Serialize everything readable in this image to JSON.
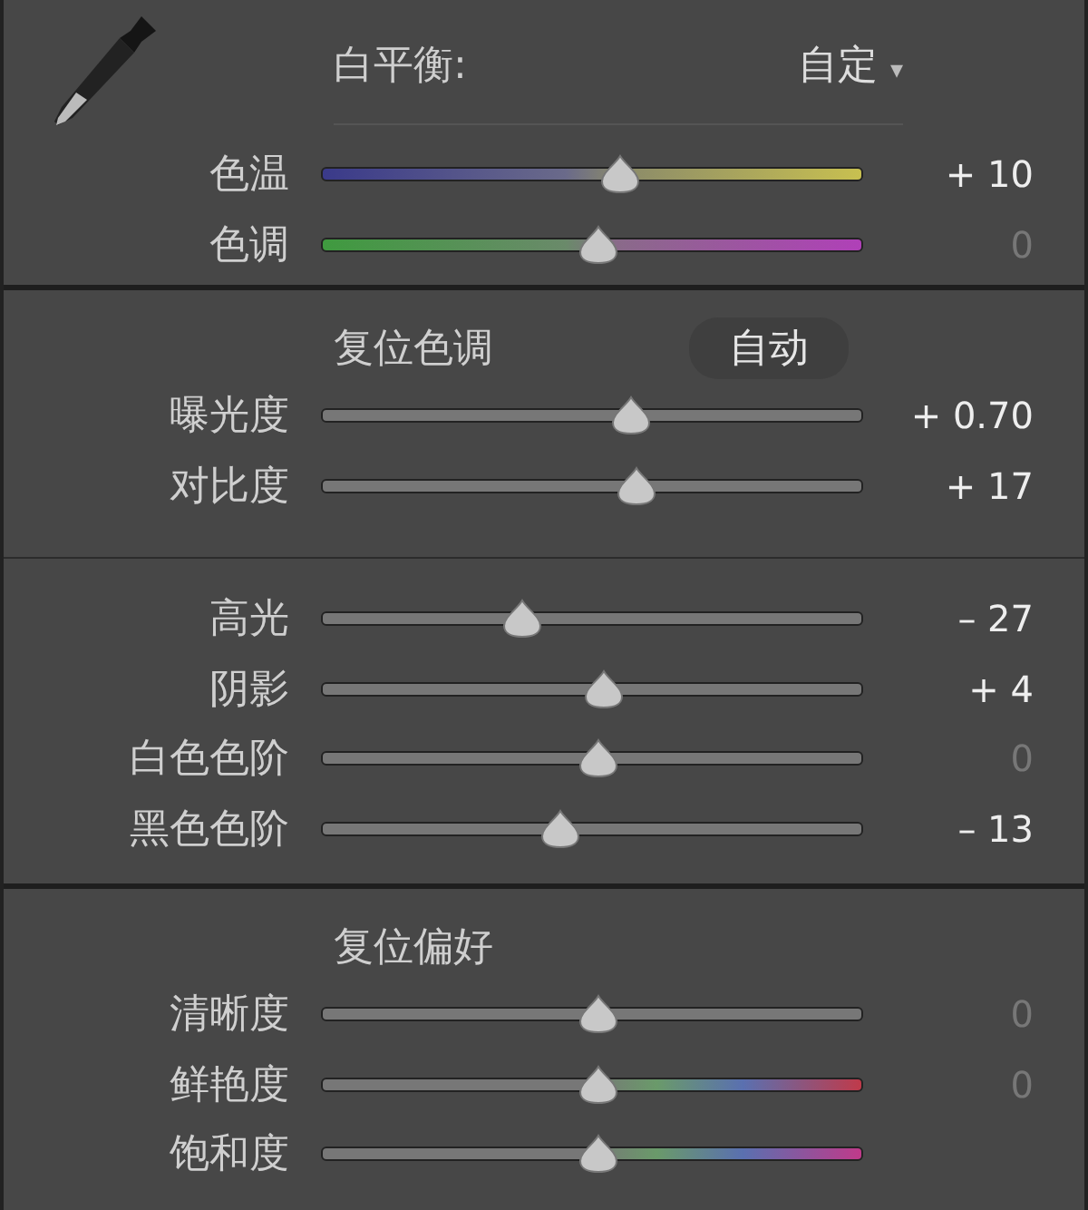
{
  "white_balance": {
    "label": "白平衡:",
    "value": "自定",
    "caret": "▾",
    "sliders": [
      {
        "label": "色温",
        "kind": "temp",
        "level": 0.55,
        "reading": "+ 10",
        "dimmed": false
      },
      {
        "label": "色调",
        "kind": "tint",
        "level": 0.51,
        "reading": "0",
        "dimmed": true
      }
    ]
  },
  "tone": {
    "reset_label": "复位色调",
    "auto_button": "自动",
    "sliders": [
      {
        "label": "曝光度",
        "kind": "plain",
        "level": 0.57,
        "reading": "+ 0.70",
        "dimmed": false
      },
      {
        "label": "对比度",
        "kind": "plain",
        "level": 0.58,
        "reading": "+ 17",
        "dimmed": false
      }
    ]
  },
  "tone_detail": {
    "sliders": [
      {
        "label": "高光",
        "kind": "plain",
        "level": 0.37,
        "reading": "– 27",
        "dimmed": false
      },
      {
        "label": "阴影",
        "kind": "plain",
        "level": 0.52,
        "reading": "+ 4",
        "dimmed": false
      },
      {
        "label": "白色色阶",
        "kind": "plain",
        "level": 0.51,
        "reading": "0",
        "dimmed": true
      },
      {
        "label": "黑色色阶",
        "kind": "plain",
        "level": 0.44,
        "reading": "– 13",
        "dimmed": false
      }
    ]
  },
  "presence": {
    "reset_label": "复位偏好",
    "sliders": [
      {
        "label": "清晰度",
        "kind": "plain",
        "level": 0.51,
        "reading": "0",
        "dimmed": true
      },
      {
        "label": "鲜艳度",
        "kind": "vibrance",
        "level": 0.51,
        "reading": "0",
        "dimmed": true
      },
      {
        "label": "饱和度",
        "kind": "saturation",
        "level": 0.51
      }
    ]
  }
}
